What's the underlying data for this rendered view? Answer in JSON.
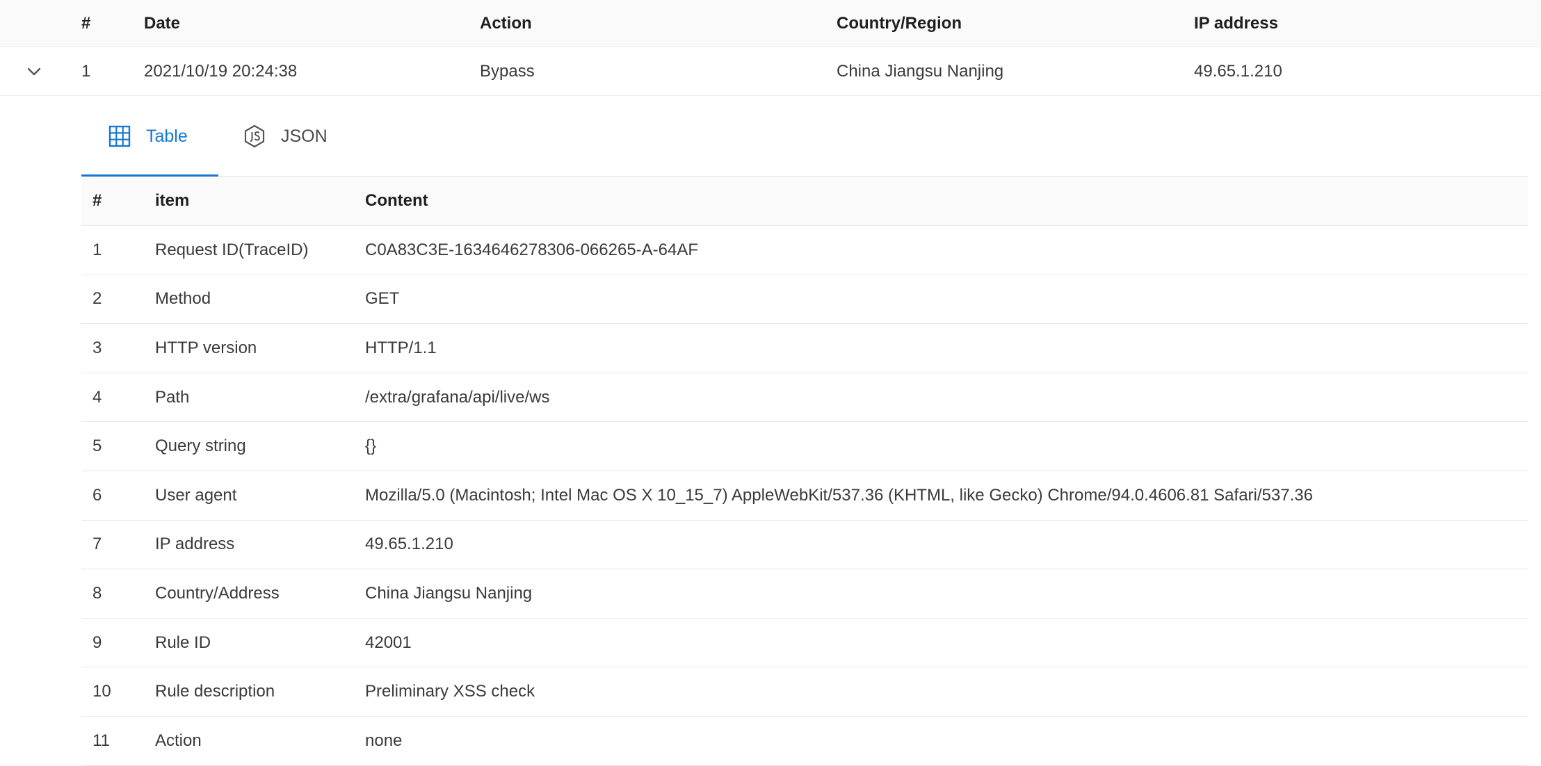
{
  "outer_table": {
    "headers": {
      "num": "#",
      "date": "Date",
      "action": "Action",
      "country": "Country/Region",
      "ip": "IP address"
    },
    "rows": [
      {
        "num": "1",
        "date": "2021/10/19 20:24:38",
        "action": "Bypass",
        "country": "China Jiangsu Nanjing",
        "ip": "49.65.1.210",
        "expanded": true
      }
    ]
  },
  "tabs": [
    {
      "label": "Table",
      "icon": "table-grid-icon",
      "active": true
    },
    {
      "label": "JSON",
      "icon": "nodejs-hexagon-icon",
      "active": false
    }
  ],
  "detail_table": {
    "headers": {
      "num": "#",
      "item": "item",
      "content": "Content"
    },
    "rows": [
      {
        "num": "1",
        "item": "Request ID(TraceID)",
        "content": "C0A83C3E-1634646278306-066265-A-64AF"
      },
      {
        "num": "2",
        "item": "Method",
        "content": "GET"
      },
      {
        "num": "3",
        "item": "HTTP version",
        "content": "HTTP/1.1"
      },
      {
        "num": "4",
        "item": "Path",
        "content": "/extra/grafana/api/live/ws"
      },
      {
        "num": "5",
        "item": "Query string",
        "content": "{}"
      },
      {
        "num": "6",
        "item": "User agent",
        "content": "Mozilla/5.0 (Macintosh; Intel Mac OS X 10_15_7) AppleWebKit/537.36 (KHTML, like Gecko) Chrome/94.0.4606.81 Safari/537.36"
      },
      {
        "num": "7",
        "item": "IP address",
        "content": "49.65.1.210"
      },
      {
        "num": "8",
        "item": "Country/Address",
        "content": "China Jiangsu Nanjing"
      },
      {
        "num": "9",
        "item": "Rule ID",
        "content": "42001"
      },
      {
        "num": "10",
        "item": "Rule description",
        "content": "Preliminary XSS check"
      },
      {
        "num": "11",
        "item": "Action",
        "content": "none"
      }
    ]
  },
  "colors": {
    "accent": "#1677d2",
    "header_bg": "#fafafa",
    "border": "#e8e8e8"
  }
}
